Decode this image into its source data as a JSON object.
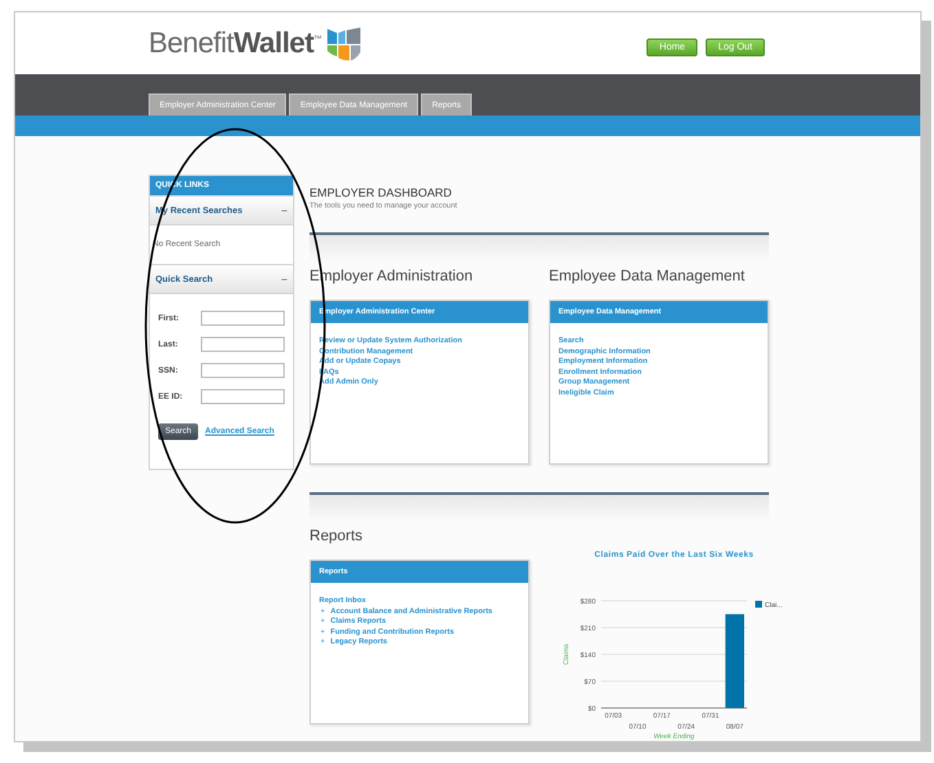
{
  "header": {
    "logo": {
      "regular": "Benefit",
      "bold": "Wallet",
      "mark": "™"
    },
    "buttons": [
      "Home",
      "Log Out"
    ]
  },
  "nav": {
    "tabs": [
      {
        "label": "Employer Administration Center",
        "selected": false
      },
      {
        "label": "Employee Data Management",
        "selected": false
      },
      {
        "label": "Reports",
        "selected": false
      }
    ]
  },
  "sidebar": {
    "title": "QUICK LINKS",
    "sections": [
      {
        "kind": "message",
        "title": "My Recent Searches",
        "toggle": "−",
        "text": "No Recent Search"
      },
      {
        "kind": "form",
        "title": "Quick Search",
        "toggle": "−",
        "fields": [
          {
            "label": "First:"
          },
          {
            "label": "Last:"
          },
          {
            "label": "SSN:"
          },
          {
            "label": "EE ID:"
          }
        ],
        "button": "Search",
        "link": "Advanced Search"
      }
    ]
  },
  "dashboard": {
    "title": "EMPLOYER DASHBOARD",
    "subtitle": "The tools you need to manage your account"
  },
  "sections": [
    {
      "heading": "Employer Administration",
      "panel": {
        "title": "Employer Administration Center",
        "links": [
          "Review or Update System Authorization",
          "Contribution Management",
          "Add or Update Copays",
          "FAQs",
          "Add Admin Only"
        ]
      }
    },
    {
      "heading": "Employee Data Management",
      "panel": {
        "title": "Employee Data Management",
        "links": [
          "Search",
          "Demographic Information",
          "Employment Information",
          "Enrollment Information",
          "Group Management",
          "Ineligible Claim"
        ]
      }
    }
  ],
  "reports": {
    "heading": "Reports",
    "panel": {
      "title": "Reports",
      "inbox": "Report Inbox",
      "items": [
        {
          "marker": "+",
          "label": "Account Balance and Administrative Reports"
        },
        {
          "marker": "+",
          "label": "Claims Reports"
        },
        {
          "marker": "+",
          "label": "Funding and Contribution Reports"
        },
        {
          "marker": "+",
          "label": "Legacy Reports"
        }
      ]
    },
    "chart_data": {
      "type": "bar",
      "title": "Claims Paid Over the Last Six Weeks",
      "xlabel": "Week Ending",
      "ylabel": "Claims",
      "categories": [
        "07/03",
        "07/10",
        "07/17",
        "07/24",
        "07/31",
        "08/07"
      ],
      "series": [
        {
          "name": "Clai...",
          "color": "#0073a8",
          "values": [
            0,
            0,
            0,
            0,
            0,
            245
          ]
        }
      ],
      "ylim": [
        0,
        280
      ],
      "grid": true,
      "yticks": [
        {
          "value": 0,
          "label": "$0"
        },
        {
          "value": 70,
          "label": "$70"
        },
        {
          "value": 140,
          "label": "$140"
        },
        {
          "value": 210,
          "label": "$210"
        },
        {
          "value": 280,
          "label": "$280"
        }
      ]
    }
  }
}
